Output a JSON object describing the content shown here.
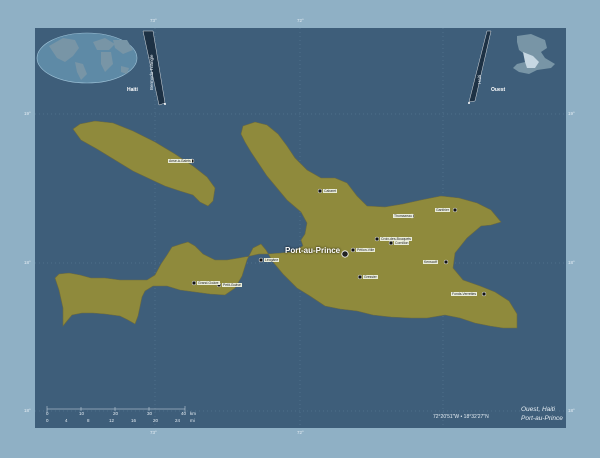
{
  "region_name": "Ouest",
  "country": "Haiti",
  "capital": "Port-au-Prince",
  "title": "Ouest, Haiti",
  "subtitle": "Port-au-Prince",
  "coordinates": "72°20'51\"W  •  18°32'27\"N",
  "inset_world_label": "Haiti",
  "inset_country_label": "Ouest",
  "inset_country_side": "Haiti",
  "inset_world_side": "Bermuda Triangle",
  "ticks": {
    "lon_left": "73°",
    "lon_mid": "72°",
    "lat_top": "19°",
    "lat_mid": "18°",
    "lat_bottom": "18°"
  },
  "scale_km": [
    "0",
    "10",
    "20",
    "30",
    "40",
    "km"
  ],
  "scale_mi": [
    "0",
    "4",
    "8",
    "12",
    "16",
    "20",
    "24",
    "mi"
  ],
  "towns": [
    "Anse-à-Galets",
    "Cabaret",
    "Thomazeau",
    "Ganthier",
    "Croix-des-Bouquets",
    "Pétion-Ville",
    "Léogâne",
    "Grand-Goâve",
    "Petit-Goâve",
    "Gressier",
    "Kenscoff",
    "Fonds-Verrettes",
    "Cornillon",
    "Carrefour"
  ],
  "colors": {
    "sea": "#3e5e7a",
    "land": "#8f8a3c",
    "frame": "#8fb0c5"
  }
}
